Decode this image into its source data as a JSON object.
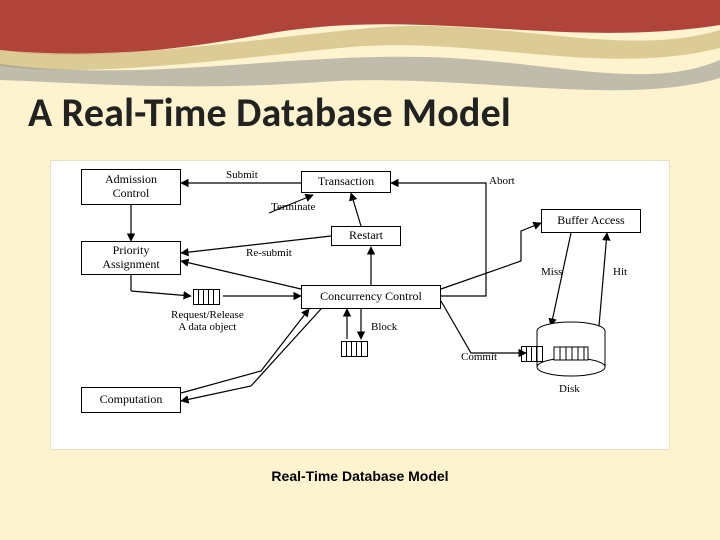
{
  "slide": {
    "title": "A Real-Time Database Model",
    "caption": "Real-Time Database Model"
  },
  "nodes": {
    "admission_control": "Admission\nControl",
    "transaction": "Transaction",
    "priority_assignment": "Priority\nAssignment",
    "restart": "Restart",
    "buffer_access": "Buffer Access",
    "concurrency_control": "Concurrency Control",
    "computation": "Computation",
    "disk_label": "Disk"
  },
  "edges": {
    "submit": "Submit",
    "terminate": "Terminate",
    "abort": "Abort",
    "resubmit": "Re-submit",
    "request_release": "Request/Release\nA data object",
    "block": "Block",
    "commit": "Commit",
    "miss": "Miss",
    "hit": "Hit"
  }
}
